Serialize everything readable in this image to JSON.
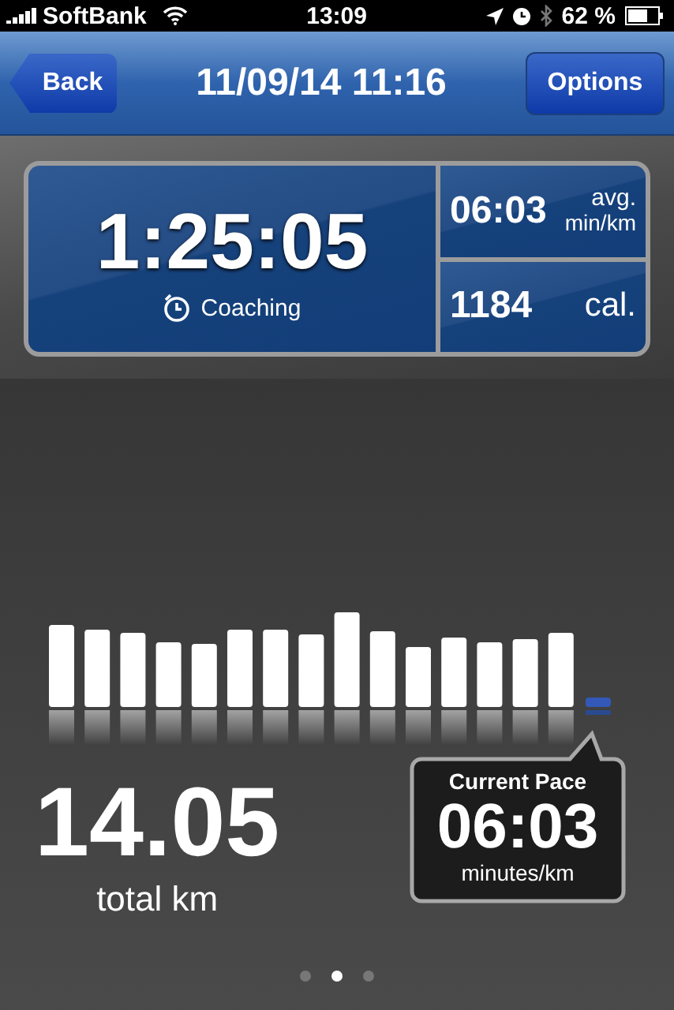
{
  "status_bar": {
    "carrier": "SoftBank",
    "time": "13:09",
    "battery": "62 %"
  },
  "nav": {
    "back": "Back",
    "title": "11/09/14 11:16",
    "options": "Options"
  },
  "summary": {
    "duration": "1:25:05",
    "coaching": "Coaching",
    "pace": "06:03",
    "pace_unit_top": "avg.",
    "pace_unit_bottom": "min/km",
    "calories": "1184",
    "calories_unit": "cal."
  },
  "distance": {
    "value": "14.05",
    "unit": "total km"
  },
  "current_pace": {
    "title": "Current Pace",
    "value": "06:03",
    "unit": "minutes/km"
  },
  "page_dots": [
    {
      "selected": false
    },
    {
      "selected": true
    },
    {
      "selected": false
    }
  ]
}
